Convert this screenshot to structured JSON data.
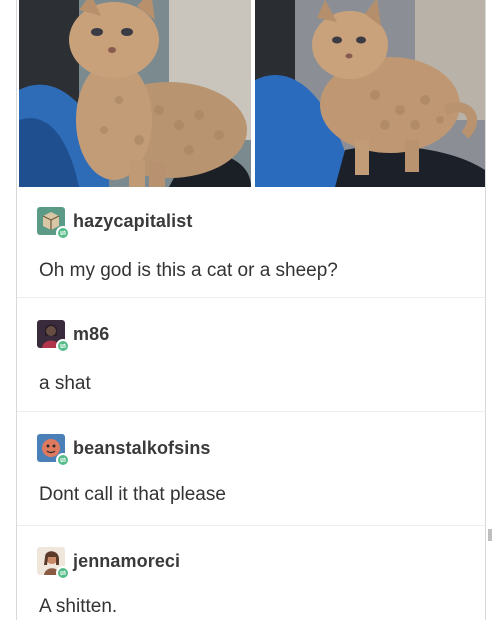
{
  "post": {
    "images": [
      {
        "name": "curly-kitten-photo-left"
      },
      {
        "name": "curly-kitten-photo-right"
      }
    ],
    "replies": [
      {
        "username": "hazycapitalist",
        "text": "Oh my god is this a cat or a sheep?",
        "avatar_icon": "cube-avatar-icon",
        "avatar_color": "#5a9a86"
      },
      {
        "username": "m86",
        "text": "a shat",
        "avatar_icon": "portrait-avatar-icon",
        "avatar_color": "#3a2b3c"
      },
      {
        "username": "beanstalkofsins",
        "text": "Dont call it that please",
        "avatar_icon": "face-avatar-icon",
        "avatar_color": "#4a7fb8"
      },
      {
        "username": "jennamoreci",
        "text": "A shitten.",
        "avatar_icon": "photo-avatar-icon",
        "avatar_color": "#c98a6a"
      }
    ]
  },
  "colors": {
    "text": "#333333",
    "username": "#3a3a3a",
    "reblog_badge": "#56bc8a",
    "divider": "#eeeeee"
  }
}
